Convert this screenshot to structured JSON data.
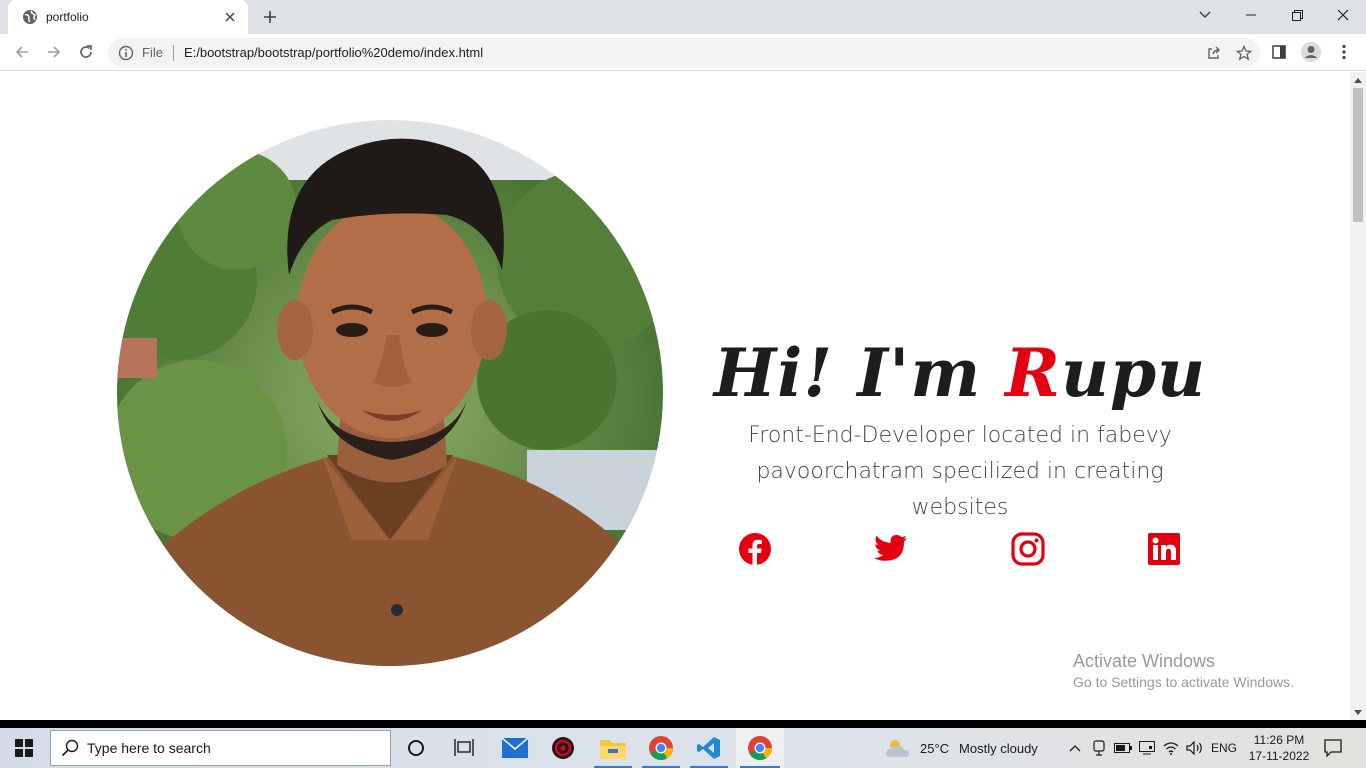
{
  "browser": {
    "tab_title": "portfolio",
    "scheme_label": "File",
    "url": "E:/bootstrap/bootstrap/portfolio%20demo/index.html"
  },
  "hero": {
    "headline_prefix": "Hi! I'm ",
    "headline_accent": "R",
    "headline_suffix": "upu",
    "tagline": "Front-End-Developer located in fabevy pavoorchatram specilized in creating websites",
    "accent_color": "#e3000f"
  },
  "socials": [
    {
      "name": "facebook-icon"
    },
    {
      "name": "twitter-icon"
    },
    {
      "name": "instagram-icon"
    },
    {
      "name": "linkedin-icon"
    }
  ],
  "watermark": {
    "title": "Activate Windows",
    "subtitle": "Go to Settings to activate Windows."
  },
  "taskbar": {
    "search_placeholder": "Type here to search",
    "weather_temp": "25°C",
    "weather_desc": "Mostly cloudy",
    "language": "ENG",
    "time": "11:26 PM",
    "date": "17-11-2022"
  }
}
